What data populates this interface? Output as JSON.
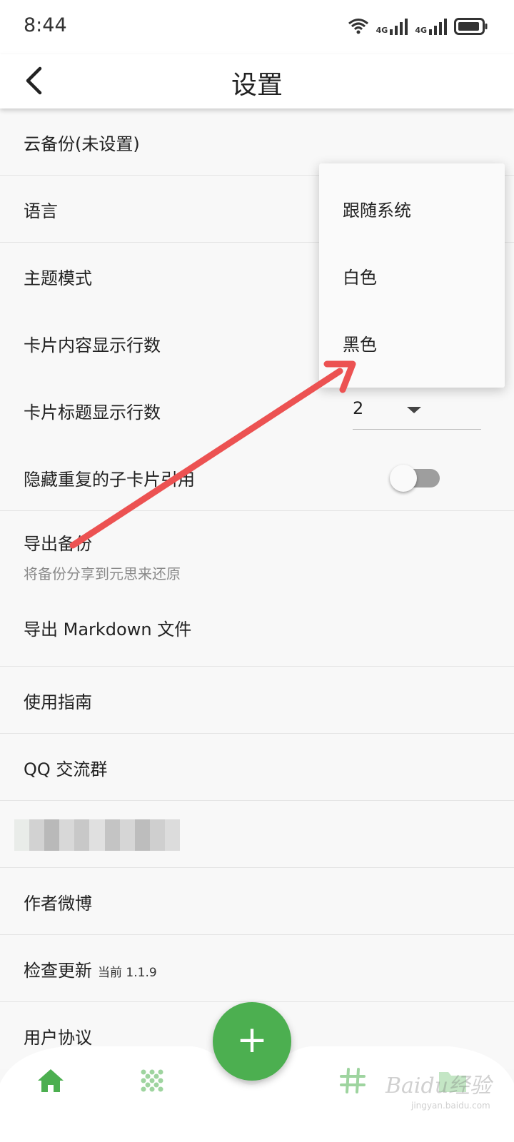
{
  "status_bar": {
    "time": "8:44",
    "network_1": "4G",
    "network_2": "4G",
    "icons": [
      "wifi-icon",
      "signal-icon",
      "signal-icon",
      "battery-icon"
    ]
  },
  "app_bar": {
    "title": "设置",
    "back_icon": "chevron-left-icon"
  },
  "settings": {
    "cloud_backup": "云备份(未设置)",
    "language": "语言",
    "theme_mode": "主题模式",
    "card_content_lines": "卡片内容显示行数",
    "card_title_lines": "卡片标题显示行数",
    "card_title_lines_value": "2",
    "hide_duplicate_refs": "隐藏重复的子卡片引用",
    "hide_duplicate_refs_on": false,
    "export_backup": "导出备份",
    "export_backup_desc": "将备份分享到元思来还原",
    "export_markdown": "导出 Markdown 文件",
    "user_guide": "使用指南",
    "qq_group": "QQ 交流群",
    "author_weibo": "作者微博",
    "check_update": "检查更新",
    "current_version": "当前 1.1.9",
    "user_agreement": "用户协议"
  },
  "theme_menu": {
    "options": [
      "跟随系统",
      "白色",
      "黑色"
    ]
  },
  "bottom_nav": {
    "items": [
      "home-icon",
      "dots-grid-icon",
      "hashtag-icon",
      "folder-icon"
    ],
    "fab_label": "+",
    "accent": "#4caf50"
  },
  "watermark": {
    "text": "Baidu经验",
    "sub": "jingyan.baidu.com"
  },
  "colors": {
    "accent": "#4caf50",
    "annotation_arrow": "#ec5252",
    "background": "#f8f8f8"
  }
}
